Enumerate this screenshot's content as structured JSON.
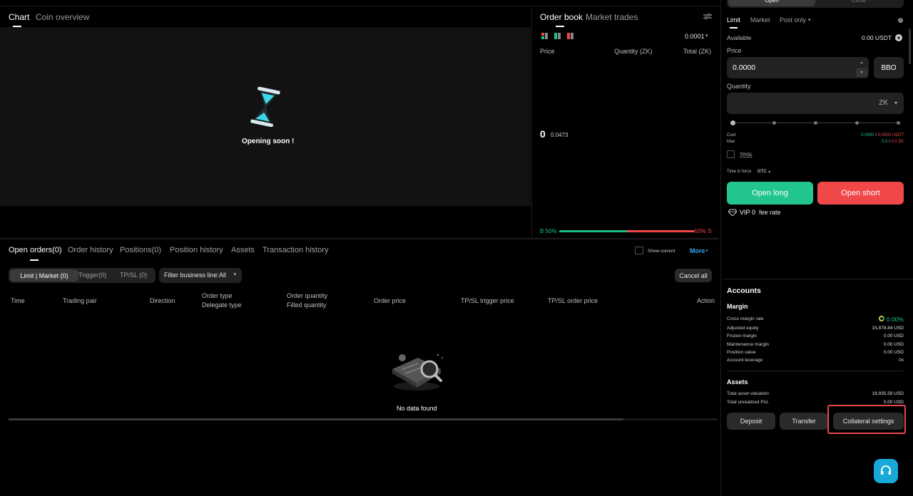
{
  "chart": {
    "tabs": [
      "Chart",
      "Coin overview"
    ],
    "opening_text": "Opening soon !"
  },
  "orderbook": {
    "tabs": [
      "Order book",
      "Market trades"
    ],
    "precision": "0.0001",
    "headers": [
      "Price",
      "Quantity (ZK)",
      "Total (ZK)"
    ],
    "mid_price": "0",
    "mid_sub": "0.0473",
    "buy_label": "B 50%",
    "sell_label": "50% S",
    "buy_fraction": 0.5,
    "colors": {
      "buy": "#19c287",
      "sell": "#f04848"
    }
  },
  "orders": {
    "tabs": [
      "Open orders(0)",
      "Order history",
      "Positions(0)",
      "Position history",
      "Assets",
      "Transaction history"
    ],
    "show_current": "Show current",
    "more": "More",
    "filters": [
      "Limit | Market (0)",
      "Trigger(0)",
      "TP/SL (0)"
    ],
    "business_filter": "Filter business line:All",
    "cancel_all": "Cancel all",
    "columns": {
      "time": "Time",
      "pair": "Trading pair",
      "direction": "Direction",
      "order_type": "Order type",
      "delegate_type": "Delegate type",
      "order_qty": "Order quantity",
      "filled_qty": "Filled quantity",
      "order_price": "Order price",
      "tpsl_trigger": "TP/SL trigger price",
      "tpsl_order": "TP/SL order price",
      "action": "Action"
    },
    "empty_text": "No data found"
  },
  "trade": {
    "top_tabs": [
      "Open",
      "Close"
    ],
    "order_types": [
      "Limit",
      "Market",
      "Post only"
    ],
    "available_label": "Available",
    "available_value": "0.00 USDT",
    "price_label": "Price",
    "price_value": "0.0000",
    "bbo": "BBO",
    "quantity_label": "Quantity",
    "quantity_unit": "ZK",
    "cost_label": "Cost",
    "cost_value_a": "0.0000",
    "cost_value_b": "0.0000 USDT",
    "max_label": "Max",
    "max_value_a": "0.0",
    "max_value_b": "0.0 ZK",
    "tpsl_label": "TP/SL",
    "tif_label": "Time in force",
    "tif_value": "GTC",
    "open_long": "Open long",
    "open_short": "Open short",
    "vip_label": "VIP",
    "vip_level": "0",
    "fee_rate": "fee rate"
  },
  "accounts": {
    "title": "Accounts",
    "margin_title": "Margin",
    "margin_rows": [
      {
        "label": "Cross margin rate",
        "value": "0.00%"
      },
      {
        "label": "Adjusted equity",
        "value": "15,878.84 USD"
      },
      {
        "label": "Frozen margin",
        "value": "0.00 USD"
      },
      {
        "label": "Maintenance margin",
        "value": "0.00 USD"
      },
      {
        "label": "Position value",
        "value": "0.00 USD"
      },
      {
        "label": "Account leverage",
        "value": "0x"
      }
    ],
    "assets_title": "Assets",
    "asset_rows": [
      {
        "label": "Total asset valuation",
        "value": "18,935.59 USD"
      },
      {
        "label": "Total unrealized PnL",
        "value": "0.00 USD"
      }
    ],
    "buttons": [
      "Deposit",
      "Transfer",
      "Collateral settings"
    ]
  }
}
